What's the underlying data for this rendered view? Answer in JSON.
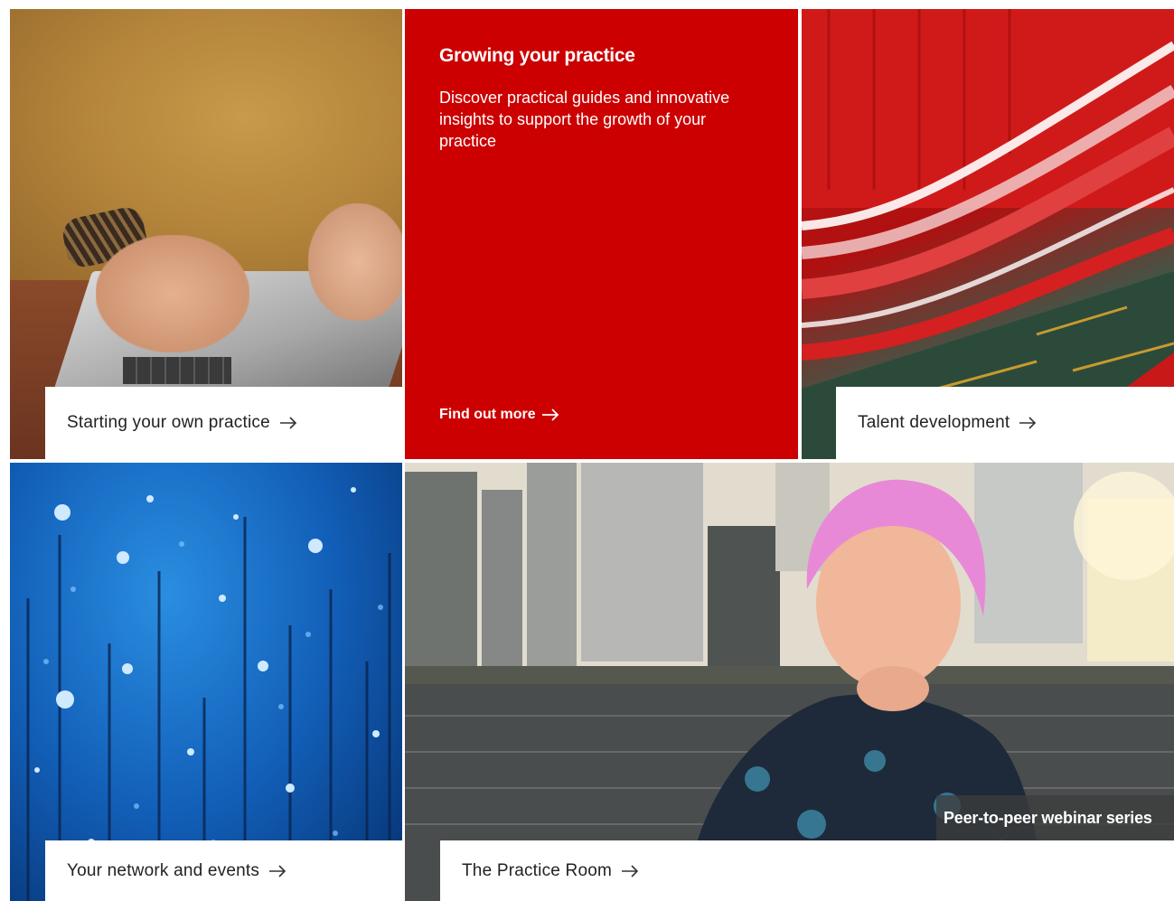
{
  "tiles": {
    "laptop": {
      "label": "Starting your own practice"
    },
    "feature": {
      "title": "Growing your practice",
      "description": "Discover practical guides and innovative insights to support the growth of your practice",
      "cta": "Find out more"
    },
    "talent": {
      "label": "Talent development"
    },
    "network": {
      "label": "Your network and events"
    },
    "room": {
      "label": "The Practice Room",
      "badge": "Peer-to-peer webinar series"
    }
  },
  "icons": {
    "arrow": "arrow-right-icon"
  },
  "colors": {
    "brand_red": "#cc0000",
    "card_bg": "#ffffff",
    "text_dark": "#222222"
  }
}
